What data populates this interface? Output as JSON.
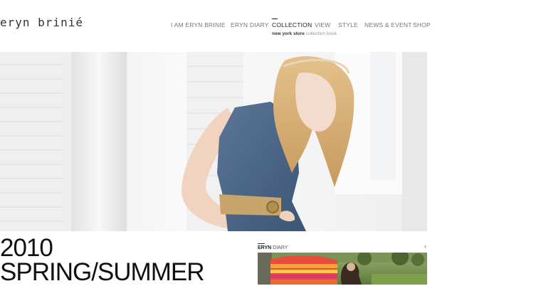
{
  "brand": {
    "logo_text": "eryn brinié"
  },
  "nav": {
    "items": [
      {
        "label": "I  AM ERYN BRINIE"
      },
      {
        "label": "ERYN DIARY"
      },
      {
        "label": "COLLECTION"
      },
      {
        "label": "VIEW"
      },
      {
        "label": "STYLE"
      },
      {
        "label": "NEWS & EVENT"
      },
      {
        "label": "SHOP"
      }
    ],
    "active": "COLLECTION"
  },
  "subnav": {
    "items": [
      {
        "label": "new york store"
      },
      {
        "label": "collection book"
      }
    ]
  },
  "season": {
    "line1": "2010",
    "line2": "SPRING/SUMMER"
  },
  "diary": {
    "label_prefix": "ERYN",
    "label_suffix": " DIARY",
    "more_symbol": "+"
  },
  "colors": {
    "text_dark": "#222222",
    "text_nav": "#777777",
    "denim": "#4a6585",
    "belt": "#c8a56a",
    "hair": "#d8b07a"
  }
}
